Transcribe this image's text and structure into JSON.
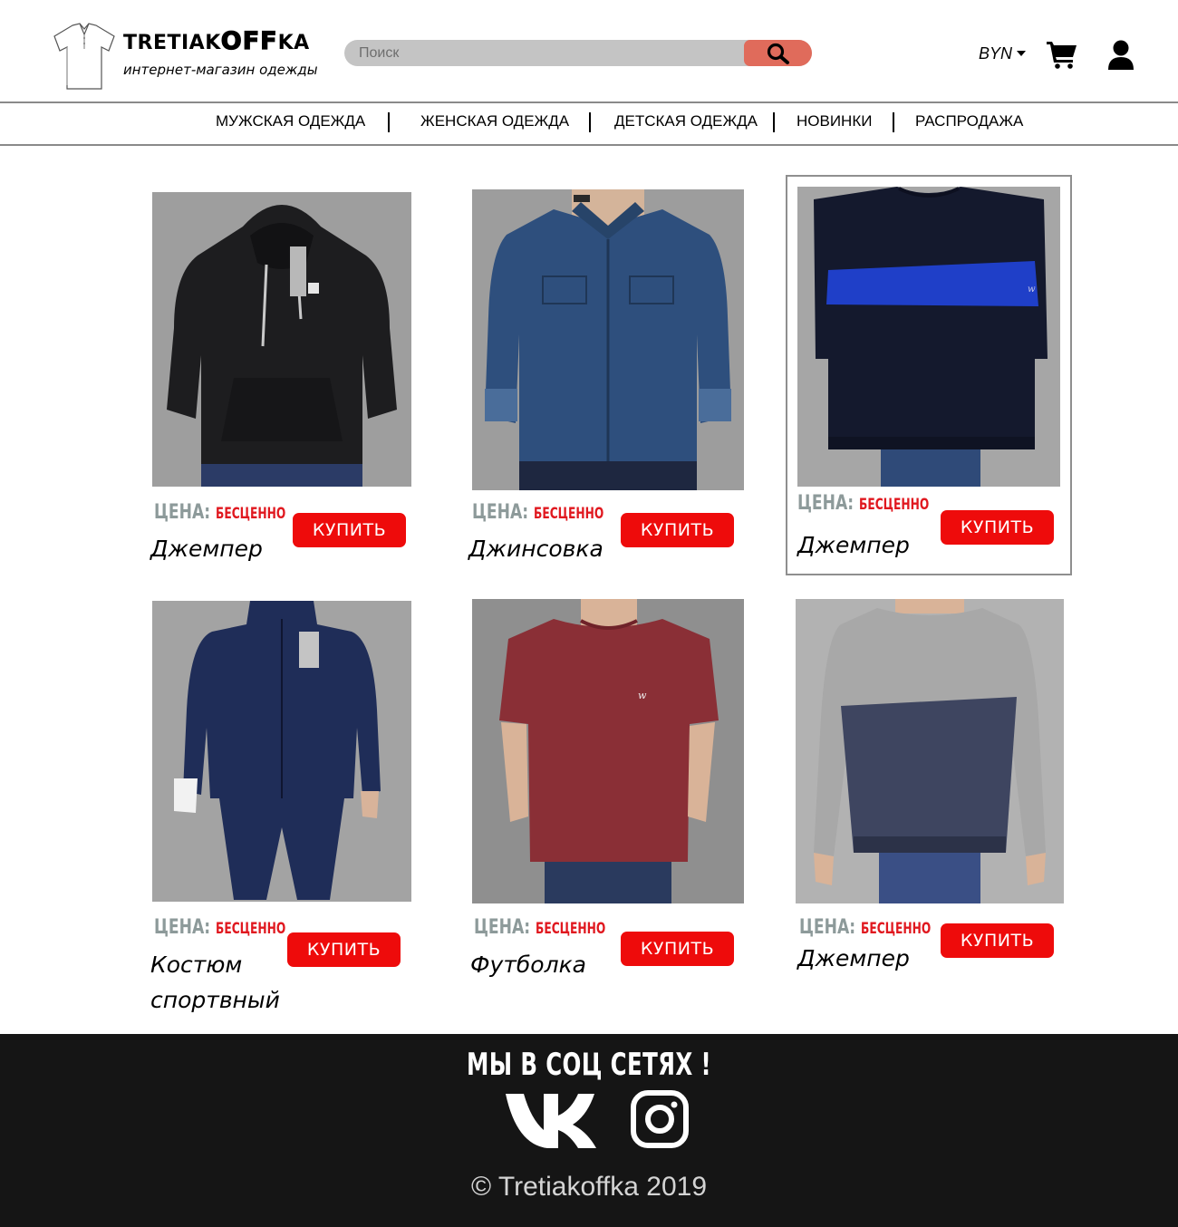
{
  "header": {
    "brand_pre": "TRETIAK",
    "brand_mid": "OFF",
    "brand_post": "KA",
    "tagline": "интернет-магазин одежды",
    "search_placeholder": "Поиск",
    "currency": "BYN"
  },
  "icons": {
    "logo": "shirt-icon",
    "search": "search-icon",
    "currency_dropdown": "caret-down-icon",
    "cart": "shopping-cart-icon",
    "account": "user-icon",
    "vk": "vk-icon",
    "instagram": "instagram-icon"
  },
  "nav": [
    {
      "label": "МУЖСКАЯ ОДЕЖДА"
    },
    {
      "label": "ЖЕНСКАЯ ОДЕЖДА"
    },
    {
      "label": "ДЕТСКАЯ ОДЕЖДА"
    },
    {
      "label": "НОВИНКИ"
    },
    {
      "label": "РАСПРОДАЖА"
    }
  ],
  "products": [
    {
      "name": "Джемпер",
      "price_label": "ЦЕНА:",
      "price": "БЕСЦЕННО",
      "buy_label": "КУПИТЬ",
      "garment": "black hoodie",
      "color": "#1d1d1f"
    },
    {
      "name": "Джинсовка",
      "price_label": "ЦЕНА:",
      "price": "БЕСЦЕННО",
      "buy_label": "КУПИТЬ",
      "garment": "denim jacket",
      "color": "#2e4f7d"
    },
    {
      "name": "Джемпер",
      "price_label": "ЦЕНА:",
      "price": "БЕСЦЕННО",
      "buy_label": "КУПИТЬ",
      "garment": "navy sweatshirt with blue stripe",
      "color": "#14192d",
      "accent": "#1f3fc8",
      "selected": true
    },
    {
      "name_line1": "Костюм",
      "name_line2": "спортвный",
      "price_label": "ЦЕНА:",
      "price": "БЕСЦЕННО",
      "buy_label": "КУПИТЬ",
      "garment": "navy tracksuit",
      "color": "#1f2d58"
    },
    {
      "name": "Футболка",
      "price_label": "ЦЕНА:",
      "price": "БЕСЦЕННО",
      "buy_label": "КУПИТЬ",
      "garment": "maroon t-shirt",
      "color": "#8a2f36"
    },
    {
      "name": "Джемпер",
      "price_label": "ЦЕНА:",
      "price": "БЕСЦЕННО",
      "buy_label": "КУПИТЬ",
      "garment": "grey and navy sweatshirt",
      "color": "#3e4560",
      "accent": "#a8a8a8"
    }
  ],
  "footer": {
    "social_title": "МЫ В СОЦ СЕТЯХ !",
    "copyright": "© Tretiakoffka 2019"
  },
  "colors": {
    "buy_button": "#ee0b0b",
    "price_value": "#e0181f",
    "price_label": "#8d9a9a",
    "search_button": "#e06b5b",
    "search_bar": "#c4c4c4",
    "footer_bg": "#151515",
    "photo_bg": "#9d9d9d"
  }
}
